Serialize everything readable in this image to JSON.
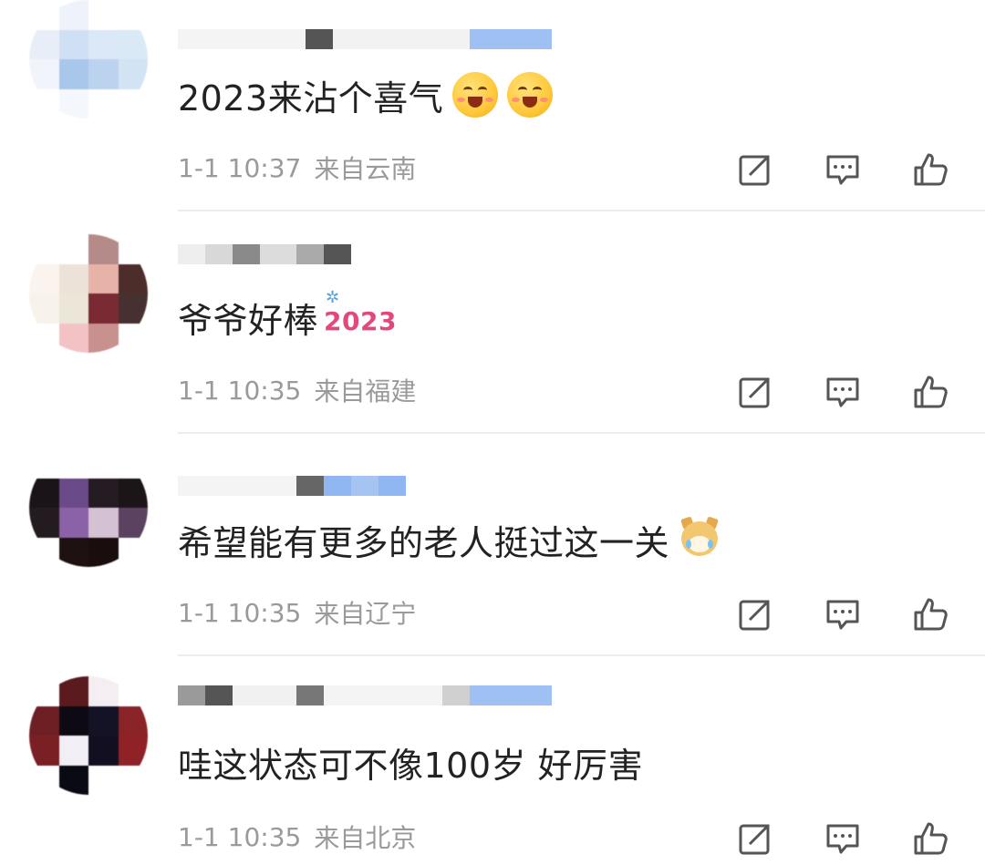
{
  "comments": [
    {
      "text": "2023来沾个喜气",
      "emoji": [
        "grinning-face",
        "grinning-face"
      ],
      "time": "1-1 10:37",
      "location": "来自云南"
    },
    {
      "text": "爷爷好棒",
      "sticker_text": "2023",
      "time": "1-1 10:35",
      "location": "来自福建"
    },
    {
      "text": "希望能有更多的老人挺过这一关",
      "emoji": [
        "crying-dog"
      ],
      "time": "1-1 10:35",
      "location": "来自辽宁"
    },
    {
      "text": "哇这状态可不像100岁 好厉害",
      "time": "1-1 10:35",
      "location": "来自北京"
    }
  ],
  "actions": {
    "icons": [
      "share-icon",
      "comment-icon",
      "like-icon"
    ]
  },
  "colors": {
    "text": "#222222",
    "meta": "#9a9a9a",
    "divider": "#ececec",
    "icon": "#555555"
  }
}
